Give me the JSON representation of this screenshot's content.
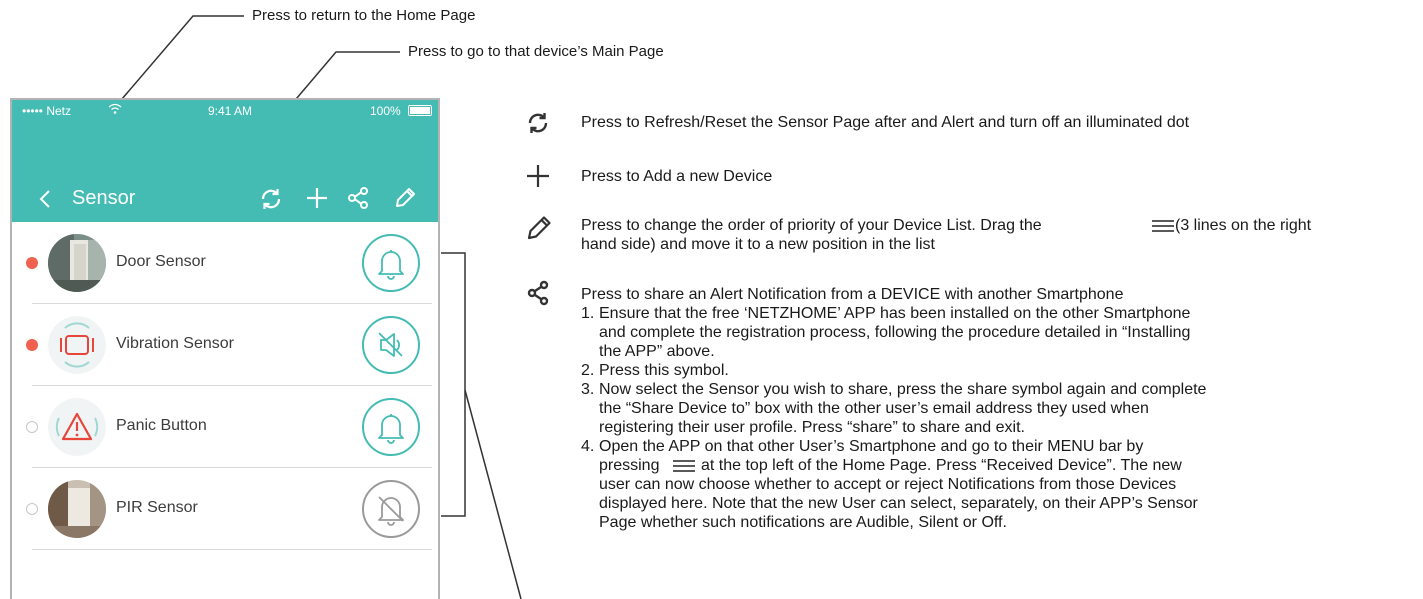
{
  "callouts": {
    "home": "Press to return to the Home Page",
    "device_main": "Press to go to that device’s Main Page"
  },
  "status_bar": {
    "carrier": "•••••  Netz",
    "time": "9:41 AM",
    "battery": "100%"
  },
  "nav": {
    "title": "Sensor"
  },
  "devices": [
    {
      "name": "Door Sensor",
      "alert_dot": true,
      "thumb_icon": "door-photo",
      "notify_icon": "bell-icon",
      "notify_state": "audible"
    },
    {
      "name": "Vibration Sensor",
      "alert_dot": true,
      "thumb_icon": "vibration-icon",
      "notify_icon": "speaker-mute-icon",
      "notify_state": "silent"
    },
    {
      "name": "Panic Button",
      "alert_dot": false,
      "thumb_icon": "panic-warning-icon",
      "notify_icon": "bell-icon",
      "notify_state": "audible"
    },
    {
      "name": "PIR Sensor",
      "alert_dot": false,
      "thumb_icon": "hallway-photo",
      "notify_icon": "bell-off-icon",
      "notify_state": "off"
    }
  ],
  "legend": {
    "refresh": "Press to Refresh/Reset the Sensor Page after and Alert and turn off an illuminated dot",
    "add": "Press to Add a new Device",
    "edit_line1_a": "Press to change the order of priority of your Device List. Drag the",
    "edit_line1_b": "(3 lines on the right",
    "edit_line2": "hand side) and move it to a new position in the list",
    "share_title": "Press to share an Alert Notification from a DEVICE with another Smartphone",
    "steps": [
      {
        "num": "1.",
        "lines": [
          "Ensure that the free ‘NETZHOME’ APP has been installed on the other Smartphone",
          "and complete the registration process, following the procedure detailed in “Installing",
          "the APP” above."
        ]
      },
      {
        "num": "2.",
        "lines": [
          "Press this symbol."
        ]
      },
      {
        "num": "3.",
        "lines": [
          "Now select the Sensor you wish to share, press the share symbol again and complete",
          "the “Share Device to” box with the other user’s email address they used when",
          "registering their user profile. Press “share” to share and exit."
        ]
      }
    ],
    "step4": {
      "num": "4.",
      "line1": "Open the APP on that other User’s Smartphone and go to their MENU bar by",
      "line2_a": "pressing",
      "line2_b": "at the top left of the Home Page. Press “Received Device”. The new",
      "rest": [
        "user can now choose whether to accept or reject Notifications from those Devices",
        "displayed here. Note that the new User can select, separately, on their APP’s Sensor",
        "Page whether such notifications are Audible, Silent or Off."
      ]
    }
  },
  "colors": {
    "accent": "#44bcb4",
    "alert_dot": "#f0624f",
    "panic_red": "#e8463a",
    "off_gray": "#9a9a9a"
  }
}
